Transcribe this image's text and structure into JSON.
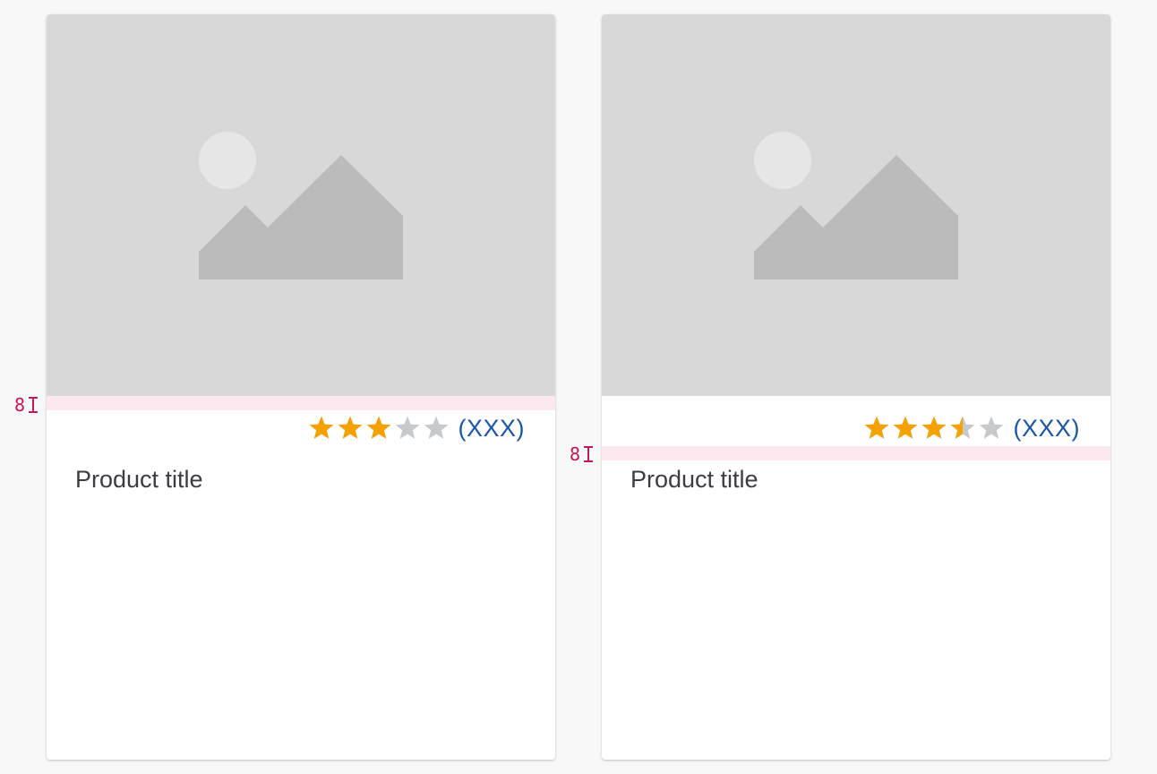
{
  "colors": {
    "page_background": "#f8f8f8",
    "card_background": "#ffffff",
    "image_placeholder": "#d8d8d8",
    "star_filled": "#f5a200",
    "star_empty": "#c8c9cc",
    "link": "#1a56a8",
    "spacing_annotation": "#c2185b"
  },
  "cards": [
    {
      "image_icon": "image-placeholder-icon",
      "rating": {
        "value": 3,
        "max": 5
      },
      "review_count": "(XXX)",
      "title": "Product title",
      "spacing_annotation": "8"
    },
    {
      "image_icon": "image-placeholder-icon",
      "rating": {
        "value": 3.5,
        "max": 5
      },
      "review_count": "(XXX)",
      "title": "Product title",
      "spacing_annotation": "8"
    }
  ]
}
